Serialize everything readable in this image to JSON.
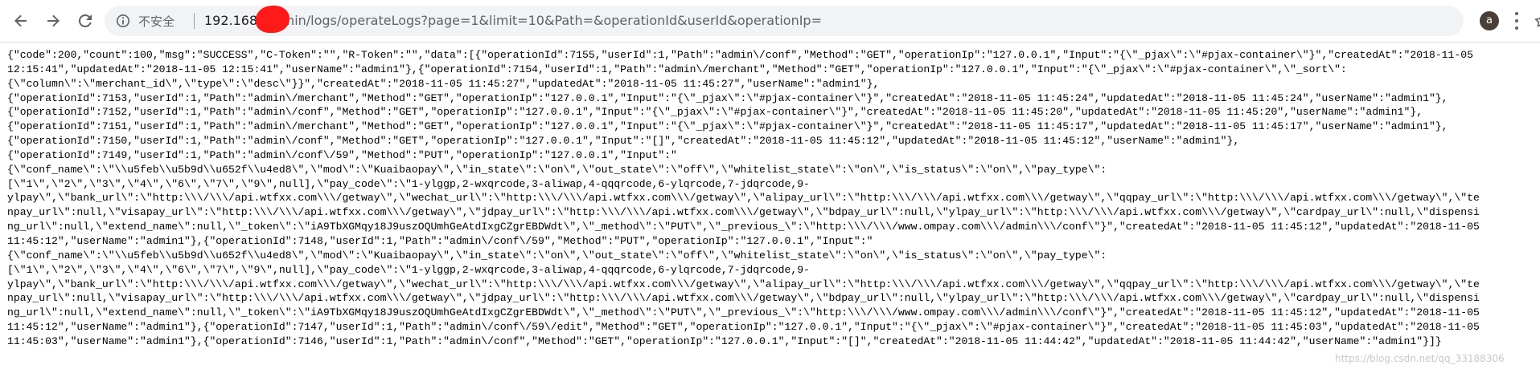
{
  "browser": {
    "security_label": "不安全",
    "url_host": "192.168.",
    "url_path": "/admin/logs/operateLogs?page=1&limit=10&Path=&operationId&userId&operationIp=",
    "profile_initial": "a",
    "icons": {
      "back": "arrow-left-icon",
      "forward": "arrow-right-icon",
      "reload": "reload-icon",
      "info": "info-icon",
      "bookmark": "star-icon",
      "menu": "kebab-menu-icon"
    },
    "redaction_color": "#ff1a1a"
  },
  "body_lines": [
    "{\"code\":200,\"count\":100,\"msg\":\"SUCCESS\",\"C-Token\":\"\",\"R-Token\":\"\",\"data\":[{\"operationId\":7155,\"userId\":1,\"Path\":\"admin\\/conf\",\"Method\":\"GET\",\"operationIp\":\"127.0.0.1\",\"Input\":\"{\\\"_pjax\\\":\\\"#pjax-container\\\"}\",\"createdAt\":\"2018-11-05",
    "12:15:41\",\"updatedAt\":\"2018-11-05 12:15:41\",\"userName\":\"admin1\"},{\"operationId\":7154,\"userId\":1,\"Path\":\"admin\\/merchant\",\"Method\":\"GET\",\"operationIp\":\"127.0.0.1\",\"Input\":\"{\\\"_pjax\\\":\\\"#pjax-container\\\",\\\"_sort\\\":",
    "{\\\"column\\\":\\\"merchant_id\\\",\\\"type\\\":\\\"desc\\\"}}\",\"createdAt\":\"2018-11-05 11:45:27\",\"updatedAt\":\"2018-11-05 11:45:27\",\"userName\":\"admin1\"},",
    "{\"operationId\":7153,\"userId\":1,\"Path\":\"admin\\/merchant\",\"Method\":\"GET\",\"operationIp\":\"127.0.0.1\",\"Input\":\"{\\\"_pjax\\\":\\\"#pjax-container\\\"}\",\"createdAt\":\"2018-11-05 11:45:24\",\"updatedAt\":\"2018-11-05 11:45:24\",\"userName\":\"admin1\"},",
    "{\"operationId\":7152,\"userId\":1,\"Path\":\"admin\\/conf\",\"Method\":\"GET\",\"operationIp\":\"127.0.0.1\",\"Input\":\"{\\\"_pjax\\\":\\\"#pjax-container\\\"}\",\"createdAt\":\"2018-11-05 11:45:20\",\"updatedAt\":\"2018-11-05 11:45:20\",\"userName\":\"admin1\"},",
    "{\"operationId\":7151,\"userId\":1,\"Path\":\"admin\\/merchant\",\"Method\":\"GET\",\"operationIp\":\"127.0.0.1\",\"Input\":\"{\\\"_pjax\\\":\\\"#pjax-container\\\"}\",\"createdAt\":\"2018-11-05 11:45:17\",\"updatedAt\":\"2018-11-05 11:45:17\",\"userName\":\"admin1\"},",
    "{\"operationId\":7150,\"userId\":1,\"Path\":\"admin\\/conf\",\"Method\":\"GET\",\"operationIp\":\"127.0.0.1\",\"Input\":\"[]\",\"createdAt\":\"2018-11-05 11:45:12\",\"updatedAt\":\"2018-11-05 11:45:12\",\"userName\":\"admin1\"},",
    "{\"operationId\":7149,\"userId\":1,\"Path\":\"admin\\/conf\\/59\",\"Method\":\"PUT\",\"operationIp\":\"127.0.0.1\",\"Input\":\"",
    "{\\\"conf_name\\\":\\\"\\\\u5feb\\\\u5b9d\\\\u652f\\\\u4ed8\\\",\\\"mod\\\":\\\"Kuaibaopay\\\",\\\"in_state\\\":\\\"on\\\",\\\"out_state\\\":\\\"off\\\",\\\"whitelist_state\\\":\\\"on\\\",\\\"is_status\\\":\\\"on\\\",\\\"pay_type\\\":",
    "[\\\"1\\\",\\\"2\\\",\\\"3\\\",\\\"4\\\",\\\"6\\\",\\\"7\\\",\\\"9\\\",null],\\\"pay_code\\\":\\\"1-ylggp,2-wxqrcode,3-aliwap,4-qqqrcode,6-ylqrcode,7-jdqrcode,9-",
    "ylpay\\\",\\\"bank_url\\\":\\\"http:\\\\\\/\\\\\\/api.wtfxx.com\\\\\\/getway\\\",\\\"wechat_url\\\":\\\"http:\\\\\\/\\\\\\/api.wtfxx.com\\\\\\/getway\\\",\\\"alipay_url\\\":\\\"http:\\\\\\/\\\\\\/api.wtfxx.com\\\\\\/getway\\\",\\\"qqpay_url\\\":\\\"http:\\\\\\/\\\\\\/api.wtfxx.com\\\\\\/getway\\\",\\\"te",
    "npay_url\\\":null,\\\"visapay_url\\\":\\\"http:\\\\\\/\\\\\\/api.wtfxx.com\\\\\\/getway\\\",\\\"jdpay_url\\\":\\\"http:\\\\\\/\\\\\\/api.wtfxx.com\\\\\\/getway\\\",\\\"bdpay_url\\\":null,\\\"ylpay_url\\\":\\\"http:\\\\\\/\\\\\\/api.wtfxx.com\\\\\\/getway\\\",\\\"cardpay_url\\\":null,\\\"dispensi",
    "ng_url\\\":null,\\\"extend_name\\\":null,\\\"_token\\\":\\\"iA9TbXGMqy18J9uszOQUmhGeAtdIxgCZgrEBDWdt\\\",\\\"_method\\\":\\\"PUT\\\",\\\"_previous_\\\":\\\"http:\\\\\\/\\\\\\/www.ompay.com\\\\\\/admin\\\\\\/conf\\\"}\",\"createdAt\":\"2018-11-05 11:45:12\",\"updatedAt\":\"2018-11-05",
    "11:45:12\",\"userName\":\"admin1\"},{\"operationId\":7148,\"userId\":1,\"Path\":\"admin\\/conf\\/59\",\"Method\":\"PUT\",\"operationIp\":\"127.0.0.1\",\"Input\":\"",
    "{\\\"conf_name\\\":\\\"\\\\u5feb\\\\u5b9d\\\\u652f\\\\u4ed8\\\",\\\"mod\\\":\\\"Kuaibaopay\\\",\\\"in_state\\\":\\\"on\\\",\\\"out_state\\\":\\\"off\\\",\\\"whitelist_state\\\":\\\"on\\\",\\\"is_status\\\":\\\"on\\\",\\\"pay_type\\\":",
    "[\\\"1\\\",\\\"2\\\",\\\"3\\\",\\\"4\\\",\\\"6\\\",\\\"7\\\",\\\"9\\\",null],\\\"pay_code\\\":\\\"1-ylggp,2-wxqrcode,3-aliwap,4-qqqrcode,6-ylqrcode,7-jdqrcode,9-",
    "ylpay\\\",\\\"bank_url\\\":\\\"http:\\\\\\/\\\\\\/api.wtfxx.com\\\\\\/getway\\\",\\\"wechat_url\\\":\\\"http:\\\\\\/\\\\\\/api.wtfxx.com\\\\\\/getway\\\",\\\"alipay_url\\\":\\\"http:\\\\\\/\\\\\\/api.wtfxx.com\\\\\\/getway\\\",\\\"qqpay_url\\\":\\\"http:\\\\\\/\\\\\\/api.wtfxx.com\\\\\\/getway\\\",\\\"te",
    "npay_url\\\":null,\\\"visapay_url\\\":\\\"http:\\\\\\/\\\\\\/api.wtfxx.com\\\\\\/getway\\\",\\\"jdpay_url\\\":\\\"http:\\\\\\/\\\\\\/api.wtfxx.com\\\\\\/getway\\\",\\\"bdpay_url\\\":null,\\\"ylpay_url\\\":\\\"http:\\\\\\/\\\\\\/api.wtfxx.com\\\\\\/getway\\\",\\\"cardpay_url\\\":null,\\\"dispensi",
    "ng_url\\\":null,\\\"extend_name\\\":null,\\\"_token\\\":\\\"iA9TbXGMqy18J9uszOQUmhGeAtdIxgCZgrEBDWdt\\\",\\\"_method\\\":\\\"PUT\\\",\\\"_previous_\\\":\\\"http:\\\\\\/\\\\\\/www.ompay.com\\\\\\/admin\\\\\\/conf\\\"}\",\"createdAt\":\"2018-11-05 11:45:12\",\"updatedAt\":\"2018-11-05",
    "11:45:12\",\"userName\":\"admin1\"},{\"operationId\":7147,\"userId\":1,\"Path\":\"admin\\/conf\\/59\\/edit\",\"Method\":\"GET\",\"operationIp\":\"127.0.0.1\",\"Input\":\"{\\\"_pjax\\\":\\\"#pjax-container\\\"}\",\"createdAt\":\"2018-11-05 11:45:03\",\"updatedAt\":\"2018-11-05",
    "11:45:03\",\"userName\":\"admin1\"},{\"operationId\":7146,\"userId\":1,\"Path\":\"admin\\/conf\",\"Method\":\"GET\",\"operationIp\":\"127.0.0.1\",\"Input\":\"[]\",\"createdAt\":\"2018-11-05 11:44:42\",\"updatedAt\":\"2018-11-05 11:44:42\",\"userName\":\"admin1\"}]}"
  ],
  "watermark": "https://blog.csdn.net/qq_33188306"
}
